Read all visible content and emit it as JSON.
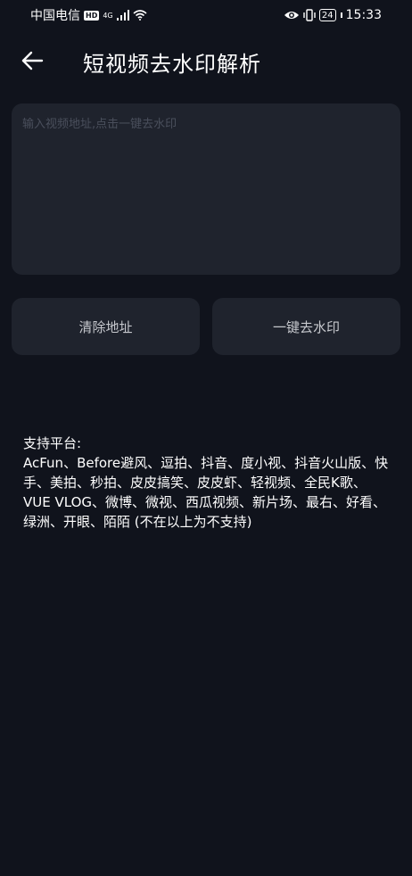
{
  "status_bar": {
    "carrier": "中国电信",
    "hd_badge": "HD",
    "network": "4G",
    "battery": "24",
    "time": "15:33"
  },
  "header": {
    "back_icon": "arrow-left-icon",
    "title": "短视频去水印解析"
  },
  "input": {
    "placeholder": "输入视频地址,点击一键去水印",
    "value": ""
  },
  "buttons": {
    "clear_label": "清除地址",
    "remove_label": "一键去水印"
  },
  "support": {
    "label": "支持平台:",
    "platforms": "AcFun、Before避风、逗拍、抖音、度小视、抖音火山版、快手、美拍、秒拍、皮皮搞笑、皮皮虾、轻视频、全民K歌、VUE VLOG、微博、微视、西瓜视频、新片场、最右、好看、绿洲、开眼、陌陌 (不在以上为不支持)"
  },
  "colors": {
    "background": "#10131c",
    "card": "#1f232d",
    "placeholder": "#4a4f5c"
  }
}
